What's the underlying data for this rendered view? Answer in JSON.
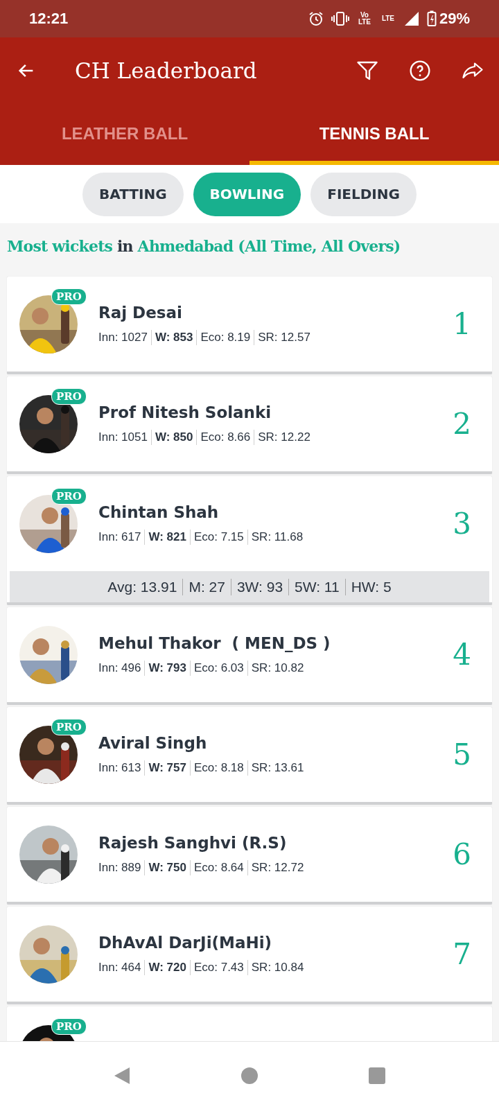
{
  "status_bar": {
    "time": "12:21",
    "indicators": [
      {
        "kind": "alarm"
      },
      {
        "kind": "vibrate"
      },
      {
        "kind": "label",
        "text": "Vo LTE"
      },
      {
        "kind": "label",
        "text": "LTE"
      },
      {
        "kind": "signal"
      },
      {
        "kind": "battery"
      }
    ],
    "battery": "29%"
  },
  "app_bar": {
    "title": "CH Leaderboard",
    "actions": [
      {
        "kind": "filter"
      },
      {
        "kind": "help"
      },
      {
        "kind": "share"
      }
    ]
  },
  "tabs": [
    {
      "label": "LEATHER BALL",
      "selected": false
    },
    {
      "label": "TENNIS BALL",
      "selected": true
    }
  ],
  "chips": [
    {
      "label": "BATTING",
      "selected": false
    },
    {
      "label": "BOWLING",
      "selected": true
    },
    {
      "label": "FIELDING",
      "selected": false
    }
  ],
  "heading": [
    {
      "text": "Most wickets",
      "highlight": true
    },
    {
      "text": " in ",
      "highlight": false
    },
    {
      "text": "Ahmedabad (All Time, All Overs)",
      "highlight": true
    }
  ],
  "players": [
    {
      "name": "Raj Desai",
      "badge": "PRO",
      "rank": "1",
      "stats": [
        {
          "text": "Inn: 1027",
          "bold": false
        },
        {
          "text": "W: 853",
          "bold": true
        },
        {
          "text": "Eco: 8.19",
          "bold": false
        },
        {
          "text": "SR: 12.57",
          "bold": false
        }
      ]
    },
    {
      "name": "Prof Nitesh Solanki",
      "badge": "PRO",
      "rank": "2",
      "stats": [
        {
          "text": "Inn: 1051",
          "bold": false
        },
        {
          "text": "W: 850",
          "bold": true
        },
        {
          "text": "Eco: 8.66",
          "bold": false
        },
        {
          "text": "SR: 12.22",
          "bold": false
        }
      ]
    },
    {
      "name": "Chintan Shah",
      "badge": "PRO",
      "rank": "3",
      "stats": [
        {
          "text": "Inn: 617",
          "bold": false
        },
        {
          "text": "W: 821",
          "bold": true
        },
        {
          "text": "Eco: 7.15",
          "bold": false
        },
        {
          "text": "SR: 11.68",
          "bold": false
        }
      ],
      "details": [
        "Avg: 13.91",
        "M: 27",
        "3W: 93",
        "5W: 11",
        "HW: 5"
      ]
    },
    {
      "name": "Mehul Thakor  ( MEN_DS )",
      "rank": "4",
      "stats": [
        {
          "text": "Inn: 496",
          "bold": false
        },
        {
          "text": "W: 793",
          "bold": true
        },
        {
          "text": "Eco: 6.03",
          "bold": false
        },
        {
          "text": "SR: 10.82",
          "bold": false
        }
      ]
    },
    {
      "name": "Aviral Singh",
      "badge": "PRO",
      "rank": "5",
      "stats": [
        {
          "text": "Inn: 613",
          "bold": false
        },
        {
          "text": "W: 757",
          "bold": true
        },
        {
          "text": "Eco: 8.18",
          "bold": false
        },
        {
          "text": "SR: 13.61",
          "bold": false
        }
      ]
    },
    {
      "name": "Rajesh Sanghvi (R.S)",
      "rank": "6",
      "stats": [
        {
          "text": "Inn: 889",
          "bold": false
        },
        {
          "text": "W: 750",
          "bold": true
        },
        {
          "text": "Eco: 8.64",
          "bold": false
        },
        {
          "text": "SR: 12.72",
          "bold": false
        }
      ]
    },
    {
      "name": "DhAvAl DarJi(MaHi)",
      "rank": "7",
      "stats": [
        {
          "text": "Inn: 464",
          "bold": false
        },
        {
          "text": "W: 720",
          "bold": true
        },
        {
          "text": "Eco: 7.43",
          "bold": false
        },
        {
          "text": "SR: 10.84",
          "bold": false
        }
      ]
    },
    {
      "badge": "PRO"
    }
  ],
  "nav_bar": [
    {
      "kind": "back"
    },
    {
      "kind": "home"
    },
    {
      "kind": "recents"
    }
  ]
}
